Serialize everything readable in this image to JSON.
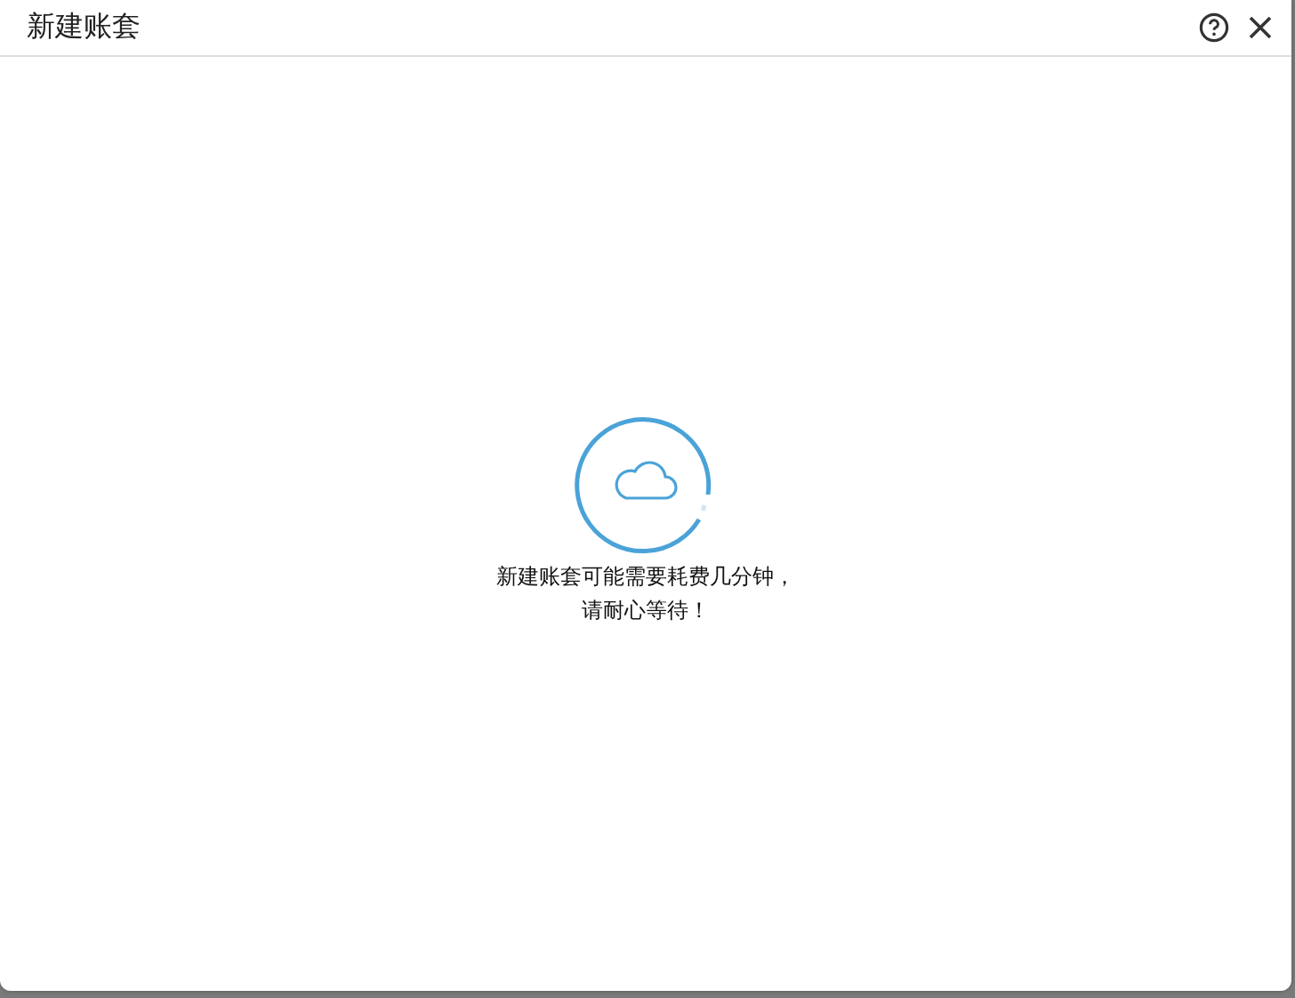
{
  "window": {
    "title": "新建账套"
  },
  "loading": {
    "lines": [
      "新建账套可能需要耗费几分钟，",
      "请耐心等待！"
    ]
  }
}
